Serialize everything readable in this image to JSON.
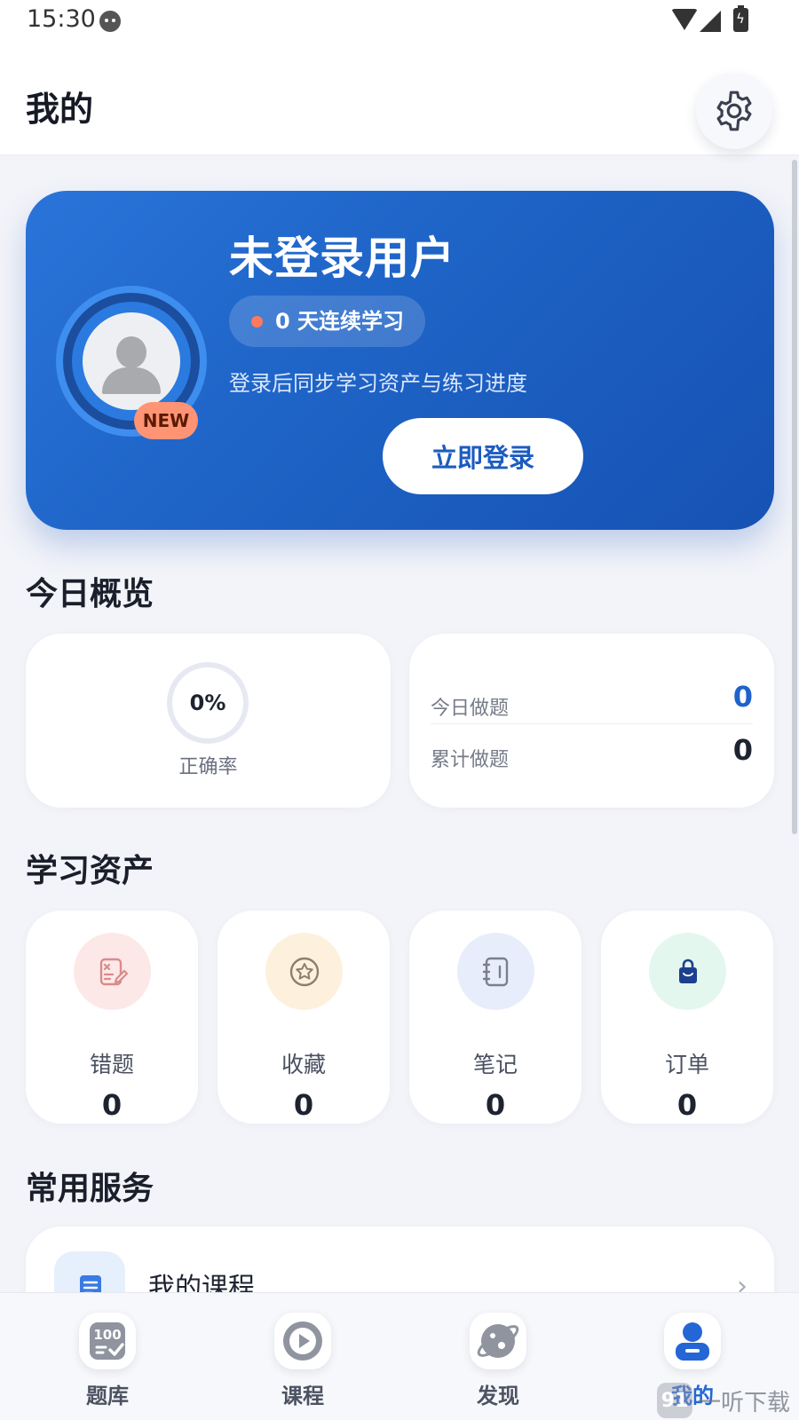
{
  "status_bar": {
    "time": "15:30",
    "icons": [
      "cat-icon",
      "wifi-icon",
      "signal-icon",
      "battery-charging-icon"
    ]
  },
  "header": {
    "title": "我的",
    "settings_icon": "gear-icon"
  },
  "profile": {
    "name": "未登录用户",
    "badge": "NEW",
    "streak": "0 天连续学习",
    "hint": "登录后同步学习资产与练习进度",
    "login_label": "立即登录"
  },
  "overview": {
    "title": "今日概览",
    "accuracy_value": "0%",
    "accuracy_label": "正确率",
    "stats": [
      {
        "label": "今日做题",
        "value": "0"
      },
      {
        "label": "累计做题",
        "value": "0"
      }
    ]
  },
  "assets": {
    "title": "学习资产",
    "items": [
      {
        "label": "错题",
        "count": "0",
        "icon": "mistake-notebook-icon",
        "icon_bg": "#fde8e8"
      },
      {
        "label": "收藏",
        "count": "0",
        "icon": "star-icon",
        "icon_bg": "#fdf1dd"
      },
      {
        "label": "笔记",
        "count": "0",
        "icon": "notebook-icon",
        "icon_bg": "#e8edfb"
      },
      {
        "label": "订单",
        "count": "0",
        "icon": "shopping-bag-icon",
        "icon_bg": "#e3f7ee"
      }
    ]
  },
  "services": {
    "title": "常用服务",
    "items": [
      {
        "label": "我的课程",
        "icon": "course-list-icon",
        "chevron": "›"
      }
    ]
  },
  "bottom_nav": {
    "items": [
      {
        "label": "题库",
        "icon": "question-bank-icon",
        "active": false
      },
      {
        "label": "课程",
        "icon": "play-icon",
        "active": false
      },
      {
        "label": "发现",
        "icon": "planet-icon",
        "active": false
      },
      {
        "label": "我的",
        "icon": "user-icon",
        "active": true
      }
    ]
  },
  "colors": {
    "primary": "#1f62cc",
    "card_gradient_start": "#2a74d9",
    "card_gradient_end": "#1652b3",
    "badge": "#ff9474",
    "background": "#f3f4f9"
  },
  "watermark": {
    "logo": "91",
    "text": "一听下载"
  }
}
